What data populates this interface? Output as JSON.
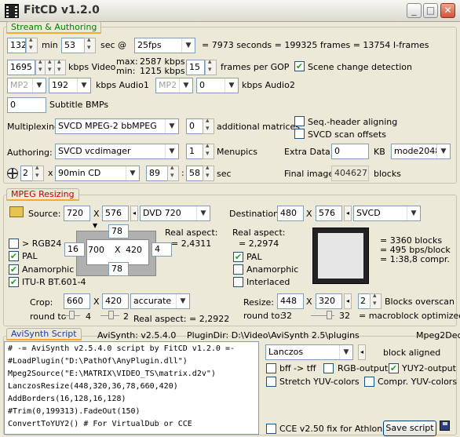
{
  "title": "FitCD v1.2.0",
  "stream": {
    "header": "Stream & Authoring",
    "minutes": "132",
    "min_label": "min",
    "seconds": "53",
    "sec_at_label": "sec @",
    "fps": "25fps",
    "summary": "= 7973 seconds = 199325 frames = 13754 I-frames",
    "video_kbps": "1695",
    "kbps_video_label": "kbps Video",
    "max_label": "max:",
    "max_value": "2587 kbps",
    "min2_label": "min:",
    "min_value": "1215 kbps",
    "gop": "15",
    "gop_label": "frames per GOP",
    "scene_detect": "Scene change detection",
    "audio1_codec": "MP2",
    "audio1_kbps": "192",
    "audio1_label": "kbps Audio1",
    "audio2_codec": "MP2",
    "audio2_kbps": "0",
    "audio2_label": "kbps Audio2",
    "subtitle_count": "0",
    "subtitle_label": "Subtitle BMPs",
    "mux_label": "Multiplexing:",
    "mux_value": "SVCD MPEG-2 bbMPEG",
    "additional": "0",
    "additional_label": "additional matrices",
    "seq_header": "Seq.-header aligning",
    "scan_offsets": "SVCD scan offsets",
    "auth_label": "Authoring:",
    "auth_value": "SVCD vcdimager",
    "menupics": "1",
    "menupics_label": "Menupics",
    "extra_label": "Extra Data:",
    "extra_value": "0",
    "kb_label": "KB",
    "mode": "mode2048",
    "discs": "2",
    "times": "x",
    "cd": "90min CD",
    "cd_min": "89",
    "colon": ":",
    "cd_sec": "58",
    "cd_sec_label": "sec",
    "final_label": "Final image:",
    "final_value": "404627",
    "blocks_label": "blocks"
  },
  "resize": {
    "header": "MPEG Resizing",
    "source_label": "Source:",
    "src_w": "720",
    "x": "X",
    "src_h": "576",
    "src_preset": "DVD 720",
    "dest_label": "Destination:",
    "dst_w": "480",
    "dst_h": "576",
    "dst_preset": "SVCD",
    "crop_top": "78",
    "crop_left": "16",
    "inner_w": "700",
    "inner_h": "420",
    "crop_right": "4",
    "crop_bottom": "78",
    "real_aspect_label": "Real aspect:",
    "real_aspect_src": "= 2,4311",
    "real_aspect_label2": "Real aspect:",
    "real_aspect_dst": "= 2,2974",
    "rgb24": "> RGB24",
    "pal": "PAL",
    "anamorphic": "Anamorphic",
    "itu": "ITU-R BT.601-4",
    "pal2": "PAL",
    "anamorphic2": "Anamorphic",
    "interlaced": "Interlaced",
    "blocks": "= 3360 blocks",
    "bps": "= 495 bps/block",
    "compr": "= 1:38,8 compr.",
    "crop_label": "Crop:",
    "crop_w": "660",
    "crop_h": "420",
    "crop_mode": "accurate",
    "round_label": "round to",
    "round1": "4",
    "round2": "2",
    "real_aspect3": "Real aspect: = 2,2922",
    "resize_label": "Resize:",
    "rs_w": "448",
    "rs_h": "320",
    "overscan": "2",
    "overscan_label": "Blocks overscan",
    "round_to2": "round to:",
    "round_val": "32",
    "round_val2": "32",
    "macro_label": "= macroblock optimized"
  },
  "avisynth": {
    "header": "AviSynth Script",
    "version": "AviSynth: v2.5.4.0",
    "plugindir": "PluginDir: D:\\Video\\AviSynth 2.5\\plugins",
    "decoder": "Mpeg2Dec",
    "lines": [
      "# -= AviSynth v2.5.4.0 script by FitCD v1.2.0 =-",
      "#LoadPlugin(\"D:\\PathOf\\AnyPlugin.dll\")",
      "Mpeg2Source(\"E:\\MATRIX\\VIDEO_TS\\matrix.d2v\")",
      "LanczosResize(448,320,36,78,660,420)",
      "AddBorders(16,128,16,128)",
      "#Trim(0,199313).FadeOut(150)",
      "ConvertToYUY2() # For VirtualDub or CCE"
    ],
    "resizer": "Lanczos",
    "block_aligned": "block aligned",
    "bff": "bff -> tff",
    "rgb_output": "RGB-output",
    "yuy2": "YUY2-output",
    "stretch": "Stretch YUV-colors",
    "compr_yuv": "Compr. YUV-colors",
    "cce": "CCE v2.50 fix for Athlons",
    "save": "Save script"
  },
  "check": "✔",
  "min_btn": "_",
  "max_btn": "□",
  "close_btn": "✕"
}
